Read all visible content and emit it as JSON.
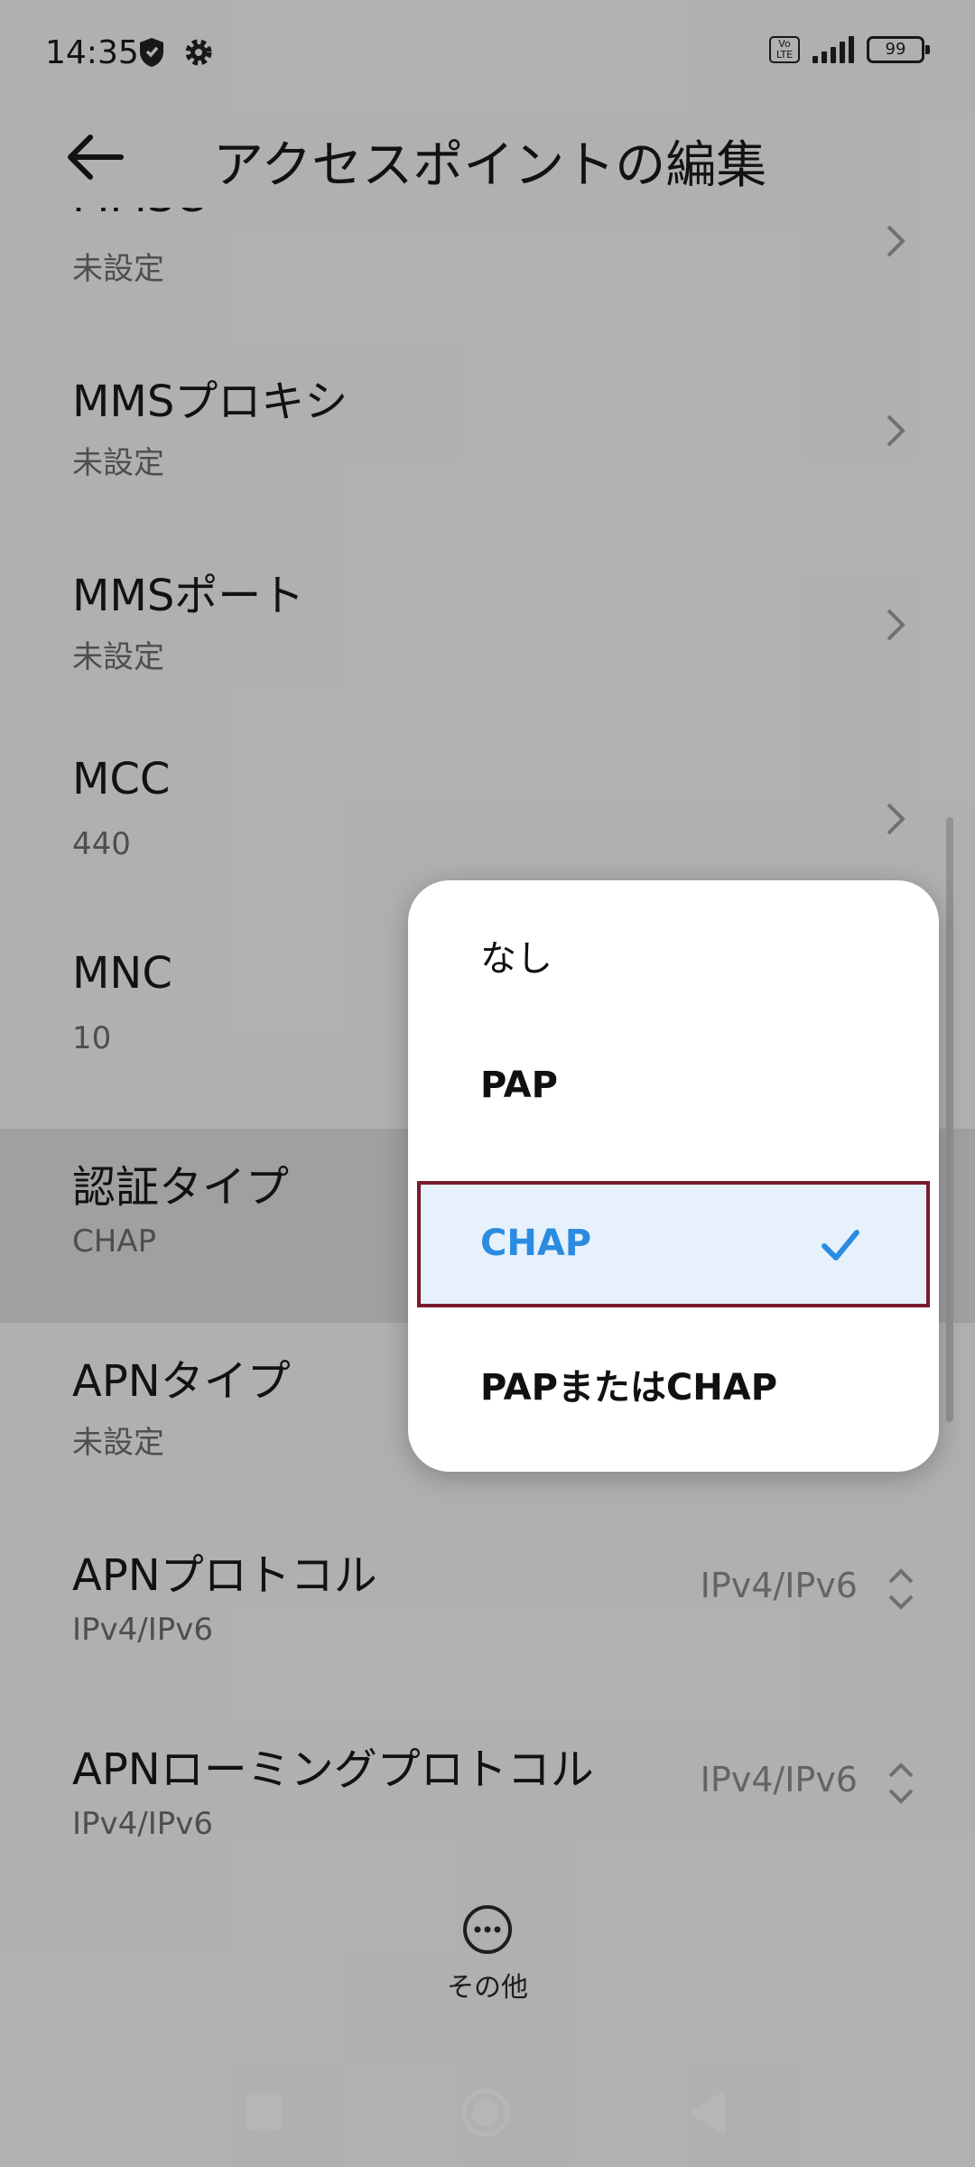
{
  "status_bar": {
    "time": "14:35",
    "volte": "Vo\nLTE",
    "battery": "99"
  },
  "header": {
    "title": "アクセスポイントの編集"
  },
  "list": [
    {
      "title": "MMSC",
      "subtitle": "未設定"
    },
    {
      "title": "MMSプロキシ",
      "subtitle": "未設定"
    },
    {
      "title": "MMSポート",
      "subtitle": "未設定"
    },
    {
      "title": "MCC",
      "subtitle": "440"
    },
    {
      "title": "MNC",
      "subtitle": "10"
    },
    {
      "title": "認証タイプ",
      "subtitle": "CHAP"
    },
    {
      "title": "APNタイプ",
      "subtitle": "未設定"
    },
    {
      "title": "APNプロトコル",
      "subtitle": "IPv4/IPv6",
      "value": "IPv4/IPv6"
    },
    {
      "title": "APNローミングプロトコル",
      "subtitle": "IPv4/IPv6",
      "value": "IPv4/IPv6"
    }
  ],
  "more": {
    "label": "その他"
  },
  "dropdown": {
    "options": [
      {
        "label": "なし"
      },
      {
        "label": "PAP"
      },
      {
        "label": "CHAP",
        "selected": true
      },
      {
        "label": "PAPまたはCHAP"
      }
    ]
  },
  "colors": {
    "accent": "#2b8be0",
    "selected_bg": "#e6f1fc",
    "highlight_border": "#7a1b2c"
  },
  "icons": [
    "back-arrow-icon",
    "shield-icon",
    "gear-icon",
    "chevron-right-icon",
    "updown-icon",
    "check-icon",
    "more-icon",
    "recents-icon",
    "home-icon",
    "back-icon"
  ]
}
